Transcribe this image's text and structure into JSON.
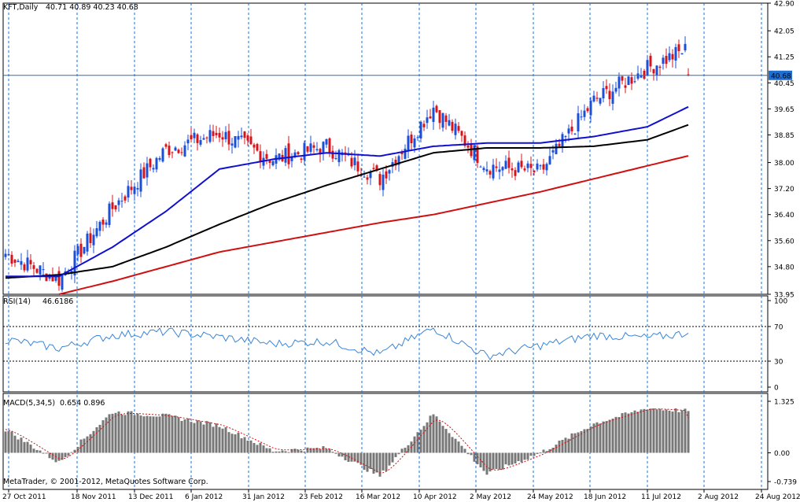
{
  "colors": {
    "background": "#ffffff",
    "frame": "#000000",
    "grid": "#1f6fd1",
    "bull_candle": "#1a4fd6",
    "bear_candle": "#d4141b",
    "ma_fast": "#1010d0",
    "ma_mid": "#000000",
    "ma_slow": "#d01010",
    "rsi_line": "#3a85d6",
    "rsi_levels": "#000000",
    "macd_hist": "#777777",
    "macd_signal": "#d01010",
    "price_tag_bg": "#1f6fd1",
    "price_tag_text": "#ffffff"
  },
  "chart_data": [
    {
      "type": "candlestick",
      "panel": "price",
      "symbol": "KFT,Daily",
      "ohlc_label": "40.71 40.89 40.23 40.68",
      "last_price": "40.68",
      "ylim": [
        33.95,
        42.9
      ],
      "y_ticks": [
        "42.90",
        "42.05",
        "41.25",
        "40.45",
        "39.65",
        "38.85",
        "38.00",
        "37.20",
        "36.40",
        "35.60",
        "34.80",
        "33.95"
      ],
      "x_ticks": [
        "27 Oct 2011",
        "18 Nov 2011",
        "13 Dec 2011",
        "6 Jan 2012",
        "31 Jan 2012",
        "23 Feb 2012",
        "16 Mar 2012",
        "10 Apr 2012",
        "2 May 2012",
        "24 May 2012",
        "18 Jun 2012",
        "11 Jul 2012",
        "2 Aug 2012",
        "24 Aug 2012"
      ],
      "close_anchors": [
        [
          "27 Oct 2011",
          35.2
        ],
        [
          "18 Nov 2011",
          34.4
        ],
        [
          "13 Dec 2011",
          36.6
        ],
        [
          "6 Jan 2012",
          38.4
        ],
        [
          "31 Jan 2012",
          38.9
        ],
        [
          "23 Feb 2012",
          38.1
        ],
        [
          "16 Mar 2012",
          38.5
        ],
        [
          "10 Apr 2012",
          37.5
        ],
        [
          "2 May 2012",
          39.7
        ],
        [
          "24 May 2012",
          37.9
        ],
        [
          "18 Jun 2012",
          37.7
        ],
        [
          "11 Jul 2012",
          39.9
        ],
        [
          "2 Aug 2012",
          40.9
        ],
        [
          "24 Aug 2012",
          41.7
        ],
        [
          "31 Aug 2012",
          40.68
        ]
      ],
      "ma_fast": [
        [
          "27 Oct 2011",
          34.5
        ],
        [
          "18 Nov 2011",
          34.5
        ],
        [
          "13 Dec 2011",
          35.4
        ],
        [
          "6 Jan 2012",
          36.5
        ],
        [
          "31 Jan 2012",
          37.8
        ],
        [
          "23 Feb 2012",
          38.1
        ],
        [
          "16 Mar 2012",
          38.3
        ],
        [
          "10 Apr 2012",
          38.2
        ],
        [
          "2 May 2012",
          38.5
        ],
        [
          "24 May 2012",
          38.6
        ],
        [
          "18 Jun 2012",
          38.6
        ],
        [
          "11 Jul 2012",
          38.8
        ],
        [
          "2 Aug 2012",
          39.1
        ],
        [
          "24 Aug 2012",
          39.9
        ],
        [
          "31 Aug 2012",
          40.25
        ]
      ],
      "ma_mid": [
        [
          "27 Oct 2011",
          34.45
        ],
        [
          "18 Nov 2011",
          34.55
        ],
        [
          "13 Dec 2011",
          34.8
        ],
        [
          "6 Jan 2012",
          35.4
        ],
        [
          "31 Jan 2012",
          36.1
        ],
        [
          "23 Feb 2012",
          36.75
        ],
        [
          "16 Mar 2012",
          37.3
        ],
        [
          "10 Apr 2012",
          37.8
        ],
        [
          "2 May 2012",
          38.3
        ],
        [
          "24 May 2012",
          38.45
        ],
        [
          "18 Jun 2012",
          38.45
        ],
        [
          "11 Jul 2012",
          38.5
        ],
        [
          "2 Aug 2012",
          38.7
        ],
        [
          "24 Aug 2012",
          39.3
        ],
        [
          "31 Aug 2012",
          39.5
        ]
      ],
      "ma_slow": [
        [
          "18 Nov 2011",
          33.95
        ],
        [
          "13 Dec 2011",
          34.35
        ],
        [
          "6 Jan 2012",
          34.8
        ],
        [
          "31 Jan 2012",
          35.25
        ],
        [
          "23 Feb 2012",
          35.55
        ],
        [
          "16 Mar 2012",
          35.85
        ],
        [
          "10 Apr 2012",
          36.15
        ],
        [
          "2 May 2012",
          36.4
        ],
        [
          "24 May 2012",
          36.75
        ],
        [
          "18 Jun 2012",
          37.1
        ],
        [
          "11 Jul 2012",
          37.5
        ],
        [
          "2 Aug 2012",
          37.9
        ],
        [
          "24 Aug 2012",
          38.3
        ],
        [
          "31 Aug 2012",
          38.55
        ]
      ]
    },
    {
      "type": "line",
      "panel": "rsi",
      "label": "RSI(14)",
      "value": "46.6186",
      "ylim": [
        0,
        100
      ],
      "y_ticks": [
        "100",
        "70",
        "30",
        "0"
      ],
      "levels": [
        70,
        30
      ],
      "anchors": [
        [
          "27 Oct 2011",
          55
        ],
        [
          "18 Nov 2011",
          45
        ],
        [
          "13 Dec 2011",
          60
        ],
        [
          "6 Jan 2012",
          64
        ],
        [
          "31 Jan 2012",
          58
        ],
        [
          "23 Feb 2012",
          50
        ],
        [
          "16 Mar 2012",
          53
        ],
        [
          "10 Apr 2012",
          38
        ],
        [
          "2 May 2012",
          68
        ],
        [
          "24 May 2012",
          36
        ],
        [
          "18 Jun 2012",
          48
        ],
        [
          "11 Jul 2012",
          60
        ],
        [
          "2 Aug 2012",
          57
        ],
        [
          "24 Aug 2012",
          64
        ],
        [
          "31 Aug 2012",
          46.6
        ]
      ]
    },
    {
      "type": "bar",
      "panel": "macd",
      "label": "MACD(5,34,5)",
      "value": "0.654 0.896",
      "ylim": [
        -0.739,
        1.325
      ],
      "y_ticks": [
        "1.325",
        "0.00",
        "-0.739"
      ],
      "anchors": [
        [
          "27 Oct 2011",
          0.6
        ],
        [
          "18 Nov 2011",
          -0.25
        ],
        [
          "13 Dec 2011",
          1.05
        ],
        [
          "6 Jan 2012",
          0.95
        ],
        [
          "31 Jan 2012",
          0.7
        ],
        [
          "23 Feb 2012",
          0.05
        ],
        [
          "16 Mar 2012",
          0.12
        ],
        [
          "10 Apr 2012",
          -0.6
        ],
        [
          "2 May 2012",
          1.0
        ],
        [
          "24 May 2012",
          -0.55
        ],
        [
          "18 Jun 2012",
          0.0
        ],
        [
          "11 Jul 2012",
          0.75
        ],
        [
          "2 Aug 2012",
          1.15
        ],
        [
          "24 Aug 2012",
          1.05
        ],
        [
          "31 Aug 2012",
          0.654
        ]
      ],
      "signal_last": 0.896
    }
  ],
  "footer": {
    "copyright": "MetaTrader, © 2001-2012, MetaQuotes Software Corp."
  }
}
